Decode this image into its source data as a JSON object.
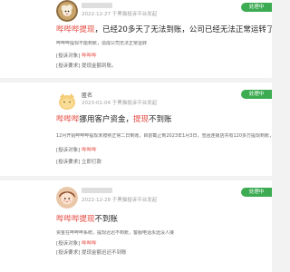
{
  "status_color": "#3cab52",
  "highlight_color": "#e5483f",
  "complaints": [
    {
      "author": "",
      "avatar_icon": "sheep-avatar-icon",
      "meta": "2022-12-27 于黑猫投诉平台发起",
      "status": "处理中",
      "title_hl": "哔哔哔提现",
      "title_rest": "，已经20多天了无法到账，公司已经无法正常运转了",
      "body": "哔哔哔提现不能到账，造成公司无法正常运转",
      "fields": [
        {
          "label": "[投诉对象]",
          "value": "哔哔哔",
          "accent": true
        },
        {
          "label": "[投诉要求]",
          "value": "提现金额到账。",
          "accent": false
        }
      ]
    },
    {
      "author": "匿名",
      "avatar_icon": "cat-avatar-icon",
      "meta": "2023-01-04 于黑猫投诉平台发起",
      "status": "处理中",
      "title_hl": "哔哔哔",
      "title_mid": "挪用客户资金，",
      "title_hl2": "提现",
      "title_rest": "不到账",
      "body": "12月开始哔哔哔提现未按照正常二日到账，目前截止到2023年1月3日，雪团连锁店共有120多万提现到账，要求哔哔哔公司立即处理，3个工作日到账。",
      "fields": [
        {
          "label": "[投诉对象]",
          "value": "哔哔哔",
          "accent": true
        },
        {
          "label": "[投诉要求]",
          "value": "立即打款",
          "accent": false
        }
      ]
    },
    {
      "author": "",
      "avatar_icon": "girl-avatar-icon",
      "meta": "2022-12-28 于黑猫投诉平台发起",
      "status": "处理中",
      "title_hl": "哔哔哔提现",
      "title_rest": "不到账",
      "body": "资金在哔哔哔系统，提现迟迟不到账，客服电话永远没人接",
      "fields": [
        {
          "label": "[投诉对象]",
          "value": "哔哔哔",
          "accent": true
        },
        {
          "label": "[投诉要求]",
          "value": "提现金额迟迟不到账",
          "accent": false
        }
      ]
    }
  ]
}
